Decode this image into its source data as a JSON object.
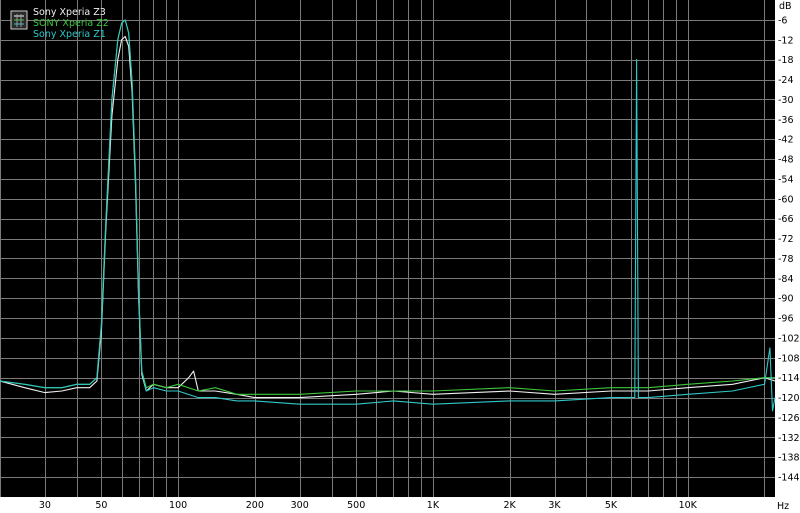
{
  "chart_data": {
    "type": "line",
    "title": "",
    "xlabel": "Hz",
    "ylabel": "dB",
    "x_scale": "log",
    "xlim": [
      20,
      22000
    ],
    "ylim": [
      -150,
      0
    ],
    "grid": true,
    "background": "#000000",
    "legend_position": "top-left",
    "x_ticks": [
      30,
      50,
      100,
      200,
      300,
      500,
      1000,
      2000,
      3000,
      5000,
      10000
    ],
    "x_tick_labels": [
      "30",
      "50",
      "100",
      "200",
      "300",
      "500",
      "1K",
      "2K",
      "3K",
      "5K",
      "10K"
    ],
    "y_ticks": [
      -6,
      -12,
      -18,
      -24,
      -30,
      -36,
      -42,
      -48,
      -54,
      -60,
      -66,
      -72,
      -78,
      -84,
      -90,
      -96,
      -102,
      -108,
      -114,
      -120,
      -126,
      -132,
      -138,
      -144
    ],
    "y_tick_labels": [
      "-6",
      "-12",
      "-18",
      "-24",
      "-30",
      "-36",
      "-42",
      "-48",
      "-54",
      "-60",
      "-66",
      "-72",
      "-78",
      "-84",
      "-90",
      "-96",
      "-102",
      "-108",
      "-114",
      "-120",
      "-126",
      "-132",
      "-138",
      "-144"
    ],
    "series": [
      {
        "name": "Sony Xperia Z3",
        "color": "#f0f0f0",
        "points": [
          [
            20,
            -115
          ],
          [
            25,
            -117
          ],
          [
            30,
            -118.5
          ],
          [
            35,
            -118
          ],
          [
            40,
            -117
          ],
          [
            45,
            -117
          ],
          [
            48,
            -115
          ],
          [
            50,
            -100
          ],
          [
            52,
            -70
          ],
          [
            55,
            -35
          ],
          [
            58,
            -18
          ],
          [
            60,
            -12
          ],
          [
            62,
            -11
          ],
          [
            64,
            -14
          ],
          [
            66,
            -28
          ],
          [
            68,
            -55
          ],
          [
            70,
            -90
          ],
          [
            72,
            -113
          ],
          [
            75,
            -118
          ],
          [
            80,
            -116
          ],
          [
            90,
            -117
          ],
          [
            100,
            -117
          ],
          [
            110,
            -114
          ],
          [
            115,
            -112
          ],
          [
            120,
            -118
          ],
          [
            140,
            -118
          ],
          [
            170,
            -119
          ],
          [
            200,
            -120
          ],
          [
            300,
            -120
          ],
          [
            500,
            -119
          ],
          [
            700,
            -118
          ],
          [
            1000,
            -119
          ],
          [
            2000,
            -118
          ],
          [
            3000,
            -119
          ],
          [
            5000,
            -118
          ],
          [
            7000,
            -118
          ],
          [
            10000,
            -117
          ],
          [
            15000,
            -116
          ],
          [
            20000,
            -114
          ],
          [
            22000,
            -115
          ]
        ]
      },
      {
        "name": "SONY Xperia Z2",
        "color": "#3cc83c",
        "points": [
          [
            20,
            -115
          ],
          [
            25,
            -116
          ],
          [
            30,
            -117
          ],
          [
            35,
            -117
          ],
          [
            40,
            -116
          ],
          [
            45,
            -116
          ],
          [
            48,
            -114
          ],
          [
            50,
            -98
          ],
          [
            52,
            -68
          ],
          [
            55,
            -30
          ],
          [
            58,
            -12
          ],
          [
            60,
            -7
          ],
          [
            62,
            -6
          ],
          [
            64,
            -10
          ],
          [
            66,
            -25
          ],
          [
            68,
            -52
          ],
          [
            70,
            -88
          ],
          [
            72,
            -112
          ],
          [
            75,
            -117
          ],
          [
            80,
            -116
          ],
          [
            90,
            -117
          ],
          [
            100,
            -116
          ],
          [
            120,
            -118
          ],
          [
            140,
            -117
          ],
          [
            170,
            -119
          ],
          [
            200,
            -119
          ],
          [
            300,
            -119
          ],
          [
            500,
            -118
          ],
          [
            700,
            -118
          ],
          [
            1000,
            -118
          ],
          [
            2000,
            -117
          ],
          [
            3000,
            -118
          ],
          [
            5000,
            -117
          ],
          [
            7000,
            -117
          ],
          [
            10000,
            -116
          ],
          [
            15000,
            -115
          ],
          [
            20000,
            -114
          ],
          [
            22000,
            -114
          ]
        ]
      },
      {
        "name": "Sony Xperia Z1",
        "color": "#30c8c8",
        "points": [
          [
            20,
            -115
          ],
          [
            25,
            -116
          ],
          [
            30,
            -117
          ],
          [
            35,
            -117
          ],
          [
            40,
            -116
          ],
          [
            45,
            -116
          ],
          [
            48,
            -114
          ],
          [
            50,
            -98
          ],
          [
            52,
            -68
          ],
          [
            55,
            -30
          ],
          [
            58,
            -12
          ],
          [
            60,
            -7
          ],
          [
            62,
            -6
          ],
          [
            64,
            -10
          ],
          [
            66,
            -25
          ],
          [
            68,
            -52
          ],
          [
            70,
            -88
          ],
          [
            72,
            -112
          ],
          [
            75,
            -118
          ],
          [
            80,
            -117
          ],
          [
            90,
            -118
          ],
          [
            100,
            -118
          ],
          [
            120,
            -120
          ],
          [
            140,
            -120
          ],
          [
            170,
            -121
          ],
          [
            200,
            -121
          ],
          [
            300,
            -122
          ],
          [
            500,
            -122
          ],
          [
            700,
            -121
          ],
          [
            1000,
            -122
          ],
          [
            2000,
            -121
          ],
          [
            3000,
            -121
          ],
          [
            5000,
            -120
          ],
          [
            6200,
            -120
          ],
          [
            6300,
            -18
          ],
          [
            6400,
            -120
          ],
          [
            7000,
            -120
          ],
          [
            10000,
            -119
          ],
          [
            15000,
            -118
          ],
          [
            20000,
            -116
          ],
          [
            21000,
            -105
          ],
          [
            21500,
            -124
          ],
          [
            22000,
            -120
          ]
        ]
      }
    ]
  }
}
